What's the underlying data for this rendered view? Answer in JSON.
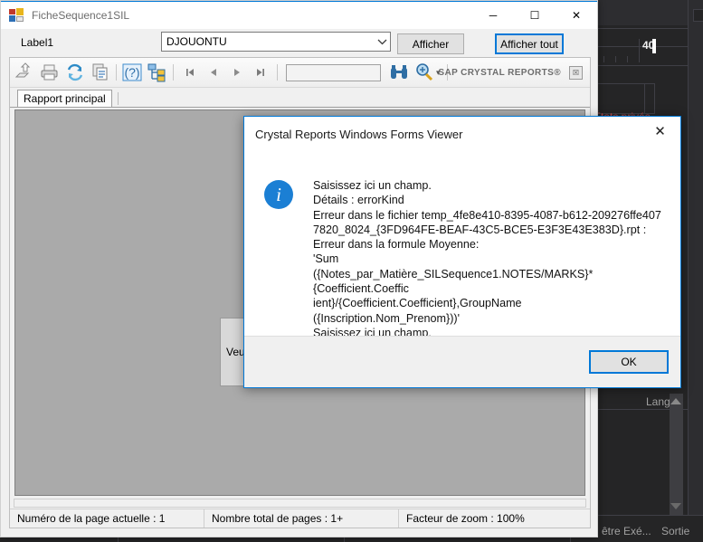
{
  "ide": {
    "ruler_value": "40",
    "private_states_label": "États privés",
    "lang_label": "Lang",
    "taskbar": {
      "window_exec": "être Exé...",
      "output": "Sortie"
    }
  },
  "window": {
    "title": "FicheSequence1SIL",
    "icon": "form-icon",
    "buttons": {
      "minimize": "─",
      "maximize": "☐",
      "close": "✕"
    }
  },
  "params": {
    "label": "Label1",
    "combo_value": "DJOUONTU",
    "combo_arrow": "chevron-down-icon",
    "btn_afficher": "Afficher",
    "btn_afficher_tout": "Afficher tout"
  },
  "viewer": {
    "toolbar_icons": [
      "export-icon",
      "print-icon",
      "refresh-icon",
      "copy-icon",
      "help-icon",
      "group-tree-icon"
    ],
    "nav": {
      "first": "⏮",
      "prev": "◀",
      "next": "▶",
      "last": "⏭"
    },
    "search_placeholder": "",
    "search_value": "",
    "find_icon": "binoculars-icon",
    "zoom_icon": "magnifier-zoom-icon",
    "zoom_dropdown": "▾",
    "brand": "SAP CRYSTAL REPORTS®",
    "brand_close": "☒",
    "tab_label": "Rapport principal",
    "report_prompt": "Veuillez",
    "status": {
      "page": "Numéro de la page actuelle : 1",
      "total": "Nombre total de pages : 1+",
      "zoom": "Facteur de zoom : 100%"
    }
  },
  "dialog": {
    "title": "Crystal Reports Windows Forms Viewer",
    "close": "✕",
    "icon": "info-icon",
    "icon_glyph": "i",
    "message": "Saisissez ici un champ.\nDétails : errorKind\nErreur dans le fichier temp_4fe8e410-8395-4087-b612-209276ffe407\n7820_8024_{3FD964FE-BEAF-43C5-BCE5-E3F3E43E383D}.rpt :\nErreur dans la formule Moyenne:\n'Sum\n({Notes_par_Matière_SILSequence1.NOTES/MARKS}*{Coefficient.Coeffic\nient}/{Coefficient.Coefficient},GroupName\n({Inscription.Nom_Prenom}))'\nSaisissez ici un champ.\nDétails : errorKind",
    "ok_label": "OK"
  },
  "colors": {
    "accent": "#0078d7",
    "info_icon": "#1b7fd4",
    "report_bg": "#aaaaaa",
    "ide_bg": "#252526"
  }
}
